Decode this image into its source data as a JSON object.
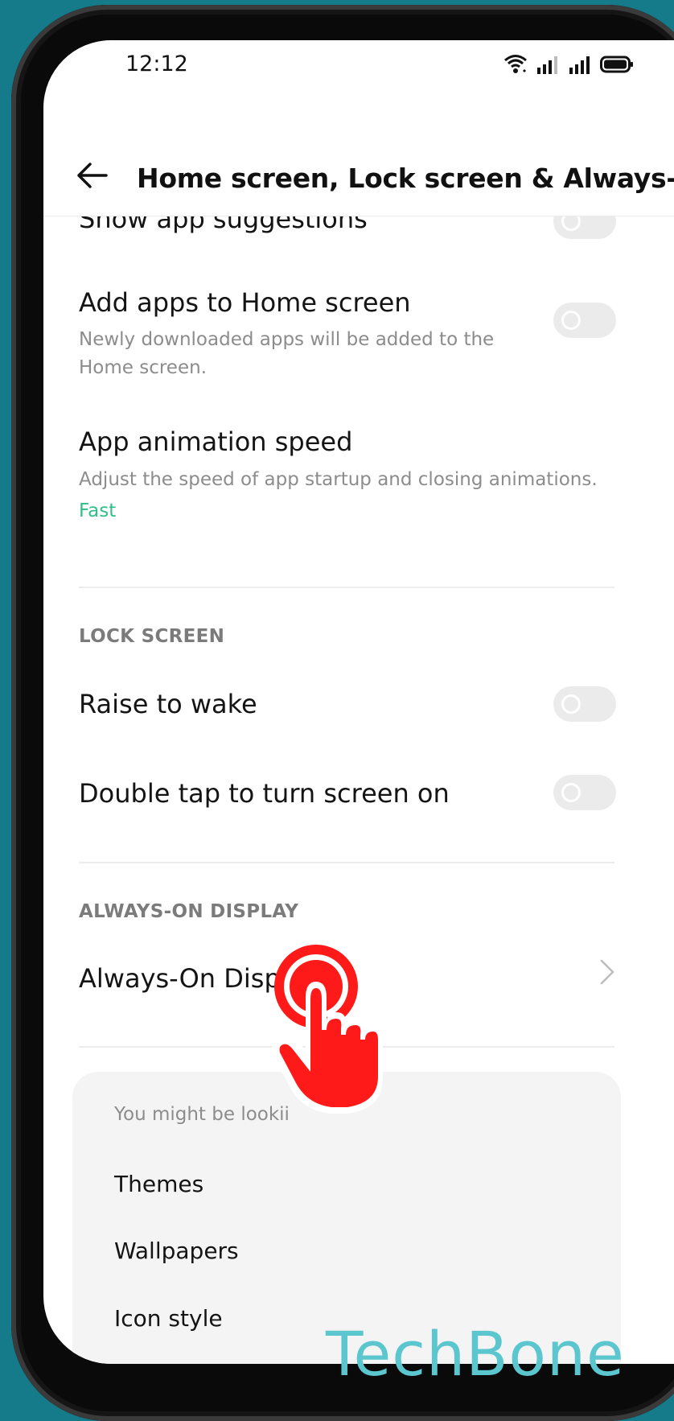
{
  "status_bar": {
    "time": "12:12",
    "icons": [
      "wifi-icon",
      "signal-icon",
      "signal-icon",
      "battery-icon"
    ]
  },
  "header": {
    "back_icon": "arrow-left-icon",
    "title": "Home screen, Lock screen & Always-O..."
  },
  "settings": {
    "show_app_suggestions": {
      "title": "Show app suggestions",
      "enabled": false
    },
    "add_apps_to_home": {
      "title": "Add apps to Home screen",
      "subtitle": "Newly downloaded apps will be added to the Home screen.",
      "enabled": false
    },
    "app_animation_speed": {
      "title": "App animation speed",
      "subtitle": "Adjust the speed of app startup and closing animations.",
      "value": "Fast"
    }
  },
  "lock_screen": {
    "section_title": "LOCK SCREEN",
    "raise_to_wake": {
      "title": "Raise to wake",
      "enabled": false
    },
    "double_tap": {
      "title": "Double tap to turn screen on",
      "enabled": false
    }
  },
  "always_on_display": {
    "section_title": "ALWAYS-ON DISPLAY",
    "item": {
      "title": "Always-On Display",
      "chevron_icon": "chevron-right-icon"
    }
  },
  "suggestions": {
    "label": "You might be lookii",
    "items": [
      "Themes",
      "Wallpapers",
      "Icon style"
    ]
  },
  "overlay": {
    "tap_icon": "tap-hand-icon",
    "watermark": "TechBone"
  },
  "colors": {
    "background": "#157a8a",
    "accent_value": "#2fbf86",
    "tap_red": "#ff1a1a",
    "watermark": "#5cc6cf"
  }
}
